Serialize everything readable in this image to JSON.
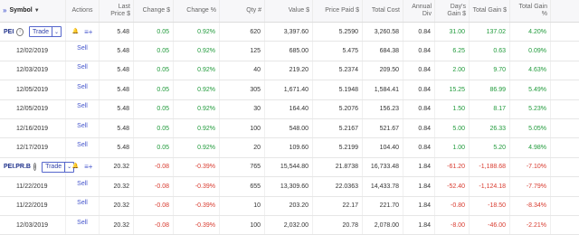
{
  "header": {
    "collapse_icon": "double-chevron-right-icon",
    "columns": [
      {
        "key": "symbol",
        "label": "Symbol",
        "sort_icon": "sort-down-icon"
      },
      {
        "key": "actions",
        "label": "Actions"
      },
      {
        "key": "last",
        "label": "Last\nPrice $"
      },
      {
        "key": "chg",
        "label": "Change $"
      },
      {
        "key": "chgpct",
        "label": "Change %"
      },
      {
        "key": "qty",
        "label": "Qty #"
      },
      {
        "key": "value",
        "label": "Value $"
      },
      {
        "key": "paid",
        "label": "Price Paid $"
      },
      {
        "key": "cost",
        "label": "Total Cost"
      },
      {
        "key": "div",
        "label": "Annual\nDiv"
      },
      {
        "key": "dgain",
        "label": "Day's\nGain $"
      },
      {
        "key": "tgain",
        "label": "Total Gain $"
      },
      {
        "key": "tgainpct",
        "label": "Total Gain %"
      }
    ]
  },
  "groups": [
    {
      "symbol": "PEI",
      "trade_label": "Trade",
      "summary": {
        "last": "5.48",
        "chg": "0.05",
        "chgpct": "0.92%",
        "qty": "620",
        "value": "3,397.60",
        "paid": "5.2590",
        "cost": "3,260.58",
        "div": "0.84",
        "dgain": "31.00",
        "tgain": "137.02",
        "tgainpct": "4.20%",
        "sign": "pos"
      },
      "lots": [
        {
          "date": "12/02/2019",
          "sell": "Sell",
          "last": "5.48",
          "chg": "0.05",
          "chgpct": "0.92%",
          "qty": "125",
          "value": "685.00",
          "paid": "5.475",
          "cost": "684.38",
          "div": "0.84",
          "dgain": "6.25",
          "tgain": "0.63",
          "tgainpct": "0.09%",
          "sign": "pos"
        },
        {
          "date": "12/03/2019",
          "sell": "Sell",
          "last": "5.48",
          "chg": "0.05",
          "chgpct": "0.92%",
          "qty": "40",
          "value": "219.20",
          "paid": "5.2374",
          "cost": "209.50",
          "div": "0.84",
          "dgain": "2.00",
          "tgain": "9.70",
          "tgainpct": "4.63%",
          "sign": "pos"
        },
        {
          "date": "12/05/2019",
          "sell": "Sell",
          "last": "5.48",
          "chg": "0.05",
          "chgpct": "0.92%",
          "qty": "305",
          "value": "1,671.40",
          "paid": "5.1948",
          "cost": "1,584.41",
          "div": "0.84",
          "dgain": "15.25",
          "tgain": "86.99",
          "tgainpct": "5.49%",
          "sign": "pos"
        },
        {
          "date": "12/05/2019",
          "sell": "Sell",
          "last": "5.48",
          "chg": "0.05",
          "chgpct": "0.92%",
          "qty": "30",
          "value": "164.40",
          "paid": "5.2076",
          "cost": "156.23",
          "div": "0.84",
          "dgain": "1.50",
          "tgain": "8.17",
          "tgainpct": "5.23%",
          "sign": "pos"
        },
        {
          "date": "12/16/2019",
          "sell": "Sell",
          "last": "5.48",
          "chg": "0.05",
          "chgpct": "0.92%",
          "qty": "100",
          "value": "548.00",
          "paid": "5.2167",
          "cost": "521.67",
          "div": "0.84",
          "dgain": "5.00",
          "tgain": "26.33",
          "tgainpct": "5.05%",
          "sign": "pos"
        },
        {
          "date": "12/17/2019",
          "sell": "Sell",
          "last": "5.48",
          "chg": "0.05",
          "chgpct": "0.92%",
          "qty": "20",
          "value": "109.60",
          "paid": "5.2199",
          "cost": "104.40",
          "div": "0.84",
          "dgain": "1.00",
          "tgain": "5.20",
          "tgainpct": "4.98%",
          "sign": "pos"
        }
      ]
    },
    {
      "symbol": "PEI.PR.B",
      "trade_label": "Trade",
      "summary": {
        "last": "20.32",
        "chg": "-0.08",
        "chgpct": "-0.39%",
        "qty": "765",
        "value": "15,544.80",
        "paid": "21.8738",
        "cost": "16,733.48",
        "div": "1.84",
        "dgain": "-61.20",
        "tgain": "-1,188.68",
        "tgainpct": "-7.10%",
        "sign": "neg"
      },
      "lots": [
        {
          "date": "11/22/2019",
          "sell": "Sell",
          "last": "20.32",
          "chg": "-0.08",
          "chgpct": "-0.39%",
          "qty": "655",
          "value": "13,309.60",
          "paid": "22.0363",
          "cost": "14,433.78",
          "div": "1.84",
          "dgain": "-52.40",
          "tgain": "-1,124.18",
          "tgainpct": "-7.79%",
          "sign": "neg"
        },
        {
          "date": "11/22/2019",
          "sell": "Sell",
          "last": "20.32",
          "chg": "-0.08",
          "chgpct": "-0.39%",
          "qty": "10",
          "value": "203.20",
          "paid": "22.17",
          "cost": "221.70",
          "div": "1.84",
          "dgain": "-0.80",
          "tgain": "-18.50",
          "tgainpct": "-8.34%",
          "sign": "neg"
        },
        {
          "date": "12/03/2019",
          "sell": "Sell",
          "last": "20.32",
          "chg": "-0.08",
          "chgpct": "-0.39%",
          "qty": "100",
          "value": "2,032.00",
          "paid": "20.78",
          "cost": "2,078.00",
          "div": "1.84",
          "dgain": "-8.00",
          "tgain": "-46.00",
          "tgainpct": "-2.21%",
          "sign": "neg"
        }
      ]
    }
  ],
  "colors": {
    "positive": "#1f9a3a",
    "negative": "#d83a2e",
    "link": "#4455cc"
  },
  "icons": {
    "alert": "bell-icon",
    "add_to_list": "add-list-icon",
    "info": "info-icon",
    "dropdown": "chevron-down-icon"
  }
}
